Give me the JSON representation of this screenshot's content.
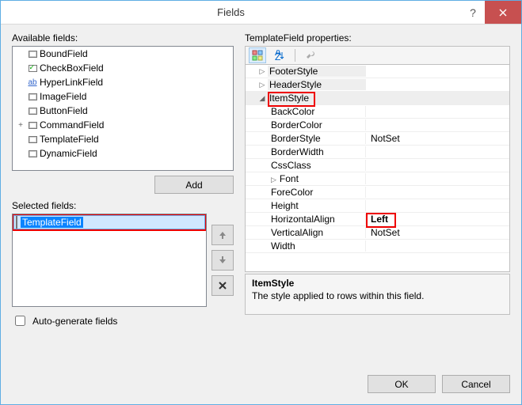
{
  "window": {
    "title": "Fields"
  },
  "leftPanel": {
    "availableLabel": "Available fields:",
    "fields": [
      {
        "exp": "",
        "icon": "box",
        "label": "BoundField"
      },
      {
        "exp": "",
        "icon": "chk",
        "label": "CheckBoxField"
      },
      {
        "exp": "",
        "icon": "link",
        "label": "HyperLinkField"
      },
      {
        "exp": "",
        "icon": "box",
        "label": "ImageField"
      },
      {
        "exp": "",
        "icon": "box",
        "label": "ButtonField"
      },
      {
        "exp": "+",
        "icon": "box",
        "label": "CommandField"
      },
      {
        "exp": "",
        "icon": "box",
        "label": "TemplateField"
      },
      {
        "exp": "",
        "icon": "box",
        "label": "DynamicField"
      }
    ],
    "addLabel": "Add",
    "selectedLabel": "Selected fields:",
    "selectedItem": "TemplateField",
    "autoGenerateLabel": "Auto-generate fields"
  },
  "rightPanel": {
    "propLabel": "TemplateField properties:",
    "rows": [
      {
        "type": "cat",
        "exp": "▷",
        "name": "FooterStyle",
        "val": ""
      },
      {
        "type": "cat",
        "exp": "▷",
        "name": "HeaderStyle",
        "val": ""
      },
      {
        "type": "cat",
        "exp": "◢",
        "name": "ItemStyle",
        "val": "",
        "hl": "itemstyle"
      },
      {
        "type": "child",
        "name": "BackColor",
        "val": ""
      },
      {
        "type": "child",
        "name": "BorderColor",
        "val": ""
      },
      {
        "type": "child",
        "name": "BorderStyle",
        "val": "NotSet"
      },
      {
        "type": "child",
        "name": "BorderWidth",
        "val": ""
      },
      {
        "type": "child",
        "name": "CssClass",
        "val": ""
      },
      {
        "type": "child",
        "exp": "▷",
        "name": "Font",
        "val": ""
      },
      {
        "type": "child",
        "name": "ForeColor",
        "val": ""
      },
      {
        "type": "child",
        "name": "Height",
        "val": ""
      },
      {
        "type": "child",
        "name": "HorizontalAlign",
        "val": "Left",
        "bold": true,
        "hl": "left"
      },
      {
        "type": "child",
        "name": "VerticalAlign",
        "val": "NotSet"
      },
      {
        "type": "child",
        "name": "Width",
        "val": ""
      }
    ],
    "descTitle": "ItemStyle",
    "descText": "The style applied to rows within this field."
  },
  "footer": {
    "ok": "OK",
    "cancel": "Cancel"
  }
}
